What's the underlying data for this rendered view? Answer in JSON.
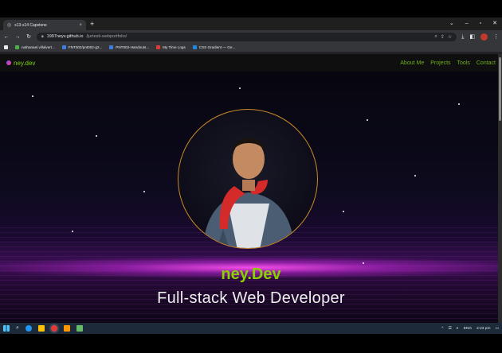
{
  "browser": {
    "tab_title": "s13-s14 Capstone",
    "url_host": "1997neyv.github.io",
    "url_path": "/jurtesti-webportfolio/",
    "window_controls": [
      "minimize-icon",
      "maximize-icon",
      "close-icon"
    ]
  },
  "bookmarks": [
    {
      "label": "nathanael.villalvert...",
      "color": "#4caf50"
    },
    {
      "label": "FNT002/pnt002-g2...",
      "color": "#3d7de0"
    },
    {
      "label": "PNT002-Handouts...",
      "color": "#3d7de0"
    },
    {
      "label": "My Time Logs",
      "color": "#e53935"
    },
    {
      "label": "CSS Gradient — Ge...",
      "color": "#1e88e5"
    }
  ],
  "site": {
    "brand": "ney.dev",
    "nav": [
      "About Me",
      "Projects",
      "Tools",
      "Contact"
    ],
    "hero_name": "ney.Dev",
    "hero_role": "Full-stack Web Developer",
    "accent": "#8ad100"
  },
  "taskbar": {
    "language": "ENG",
    "time": "2:23 pm"
  }
}
